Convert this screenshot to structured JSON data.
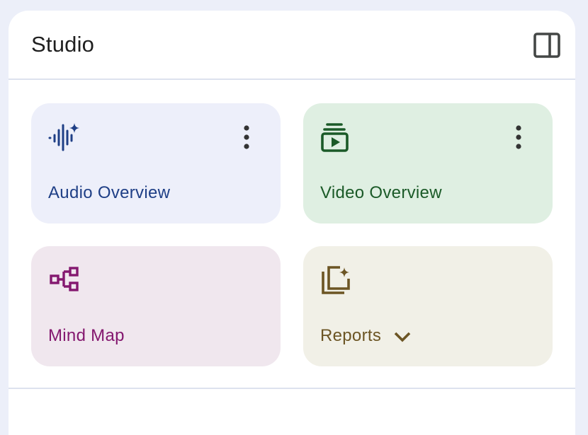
{
  "studio": {
    "title": "Studio",
    "collapse_icon": "panel-toggle-icon"
  },
  "cards": {
    "audio": {
      "label": "Audio Overview",
      "icon": "audio-waveform-sparkle-icon",
      "color": "#1f3f86",
      "background": "#edeffa"
    },
    "video": {
      "label": "Video Overview",
      "icon": "video-stack-play-icon",
      "color": "#1b5a28",
      "background": "#dfefe2"
    },
    "mind_map": {
      "label": "Mind Map",
      "icon": "mind-map-tree-icon",
      "color": "#84186f",
      "background": "#f0e7ee"
    },
    "reports": {
      "label": "Reports",
      "icon": "reports-sparkle-icon",
      "color": "#6c5524",
      "background": "#f1f0e7",
      "dropdown_icon": "chevron-down-icon"
    }
  }
}
